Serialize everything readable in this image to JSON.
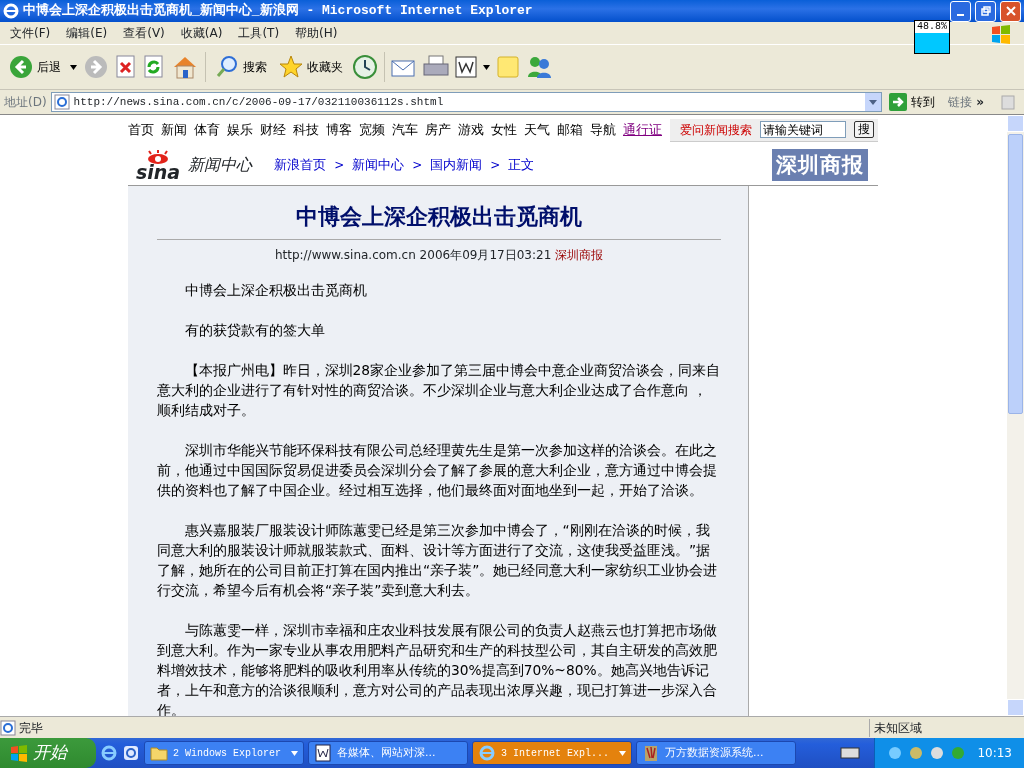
{
  "window": {
    "title": "中博会上深企积极出击觅商机_新闻中心_新浪网 - Microsoft Internet Explorer"
  },
  "overlay_meter": {
    "reading": "48.8%"
  },
  "menu": [
    "文件(F)",
    "编辑(E)",
    "查看(V)",
    "收藏(A)",
    "工具(T)",
    "帮助(H)"
  ],
  "toolbar": {
    "back": "后退",
    "search": "搜索",
    "favorites": "收藏夹"
  },
  "address_bar": {
    "label": "地址(D)",
    "url": "http://news.sina.com.cn/c/2006-09-17/032110036112s.shtml",
    "go": "转到",
    "links": "链接",
    "more": "»"
  },
  "site_nav": [
    {
      "label": "首页",
      "visited": false
    },
    {
      "label": "新闻",
      "visited": false
    },
    {
      "label": "体育",
      "visited": false
    },
    {
      "label": "娱乐",
      "visited": false
    },
    {
      "label": "财经",
      "visited": false
    },
    {
      "label": "科技",
      "visited": false
    },
    {
      "label": "博客",
      "visited": false
    },
    {
      "label": "宽频",
      "visited": false
    },
    {
      "label": "汽车",
      "visited": false
    },
    {
      "label": "房产",
      "visited": false
    },
    {
      "label": "游戏",
      "visited": false
    },
    {
      "label": "女性",
      "visited": false
    },
    {
      "label": "天气",
      "visited": false
    },
    {
      "label": "邮箱",
      "visited": false
    },
    {
      "label": "导航",
      "visited": false
    },
    {
      "label": "通行证",
      "visited": true
    }
  ],
  "search_box": {
    "label": "爱问新闻搜索",
    "value": "请输关键词",
    "button": "搜"
  },
  "channel": {
    "logo": "sina",
    "name": "新闻中心",
    "breadcrumb": [
      "新浪首页",
      "新闻中心",
      "国内新闻",
      "正文"
    ],
    "separator": ">"
  },
  "source_logo": "深圳商报",
  "article": {
    "title": "中博会上深企积极出击觅商机",
    "meta": "http://www.sina.com.cn 2006年09月17日03:21",
    "source": "深圳商报",
    "paragraphs": [
      "中博会上深企积极出击觅商机",
      "有的获贷款有的签大单",
      "【本报广州电】昨日，深圳28家企业参加了第三届中博会中意企业商贸洽谈会，同来自意大利的企业进行了有针对性的商贸洽谈。不少深圳企业与意大利企业达成了合作意向 ，顺利结成对子。",
      "深圳市华能兴节能环保科技有限公司总经理黄先生是第一次参加这样的洽谈会。在此之前，他通过中国国际贸易促进委员会深圳分会了解了参展的意大利企业，意方通过中博会提供的资料也了解了中国企业。经过相互选择，他们最终面对面地坐到一起，开始了洽谈。",
      "惠兴嘉服装厂服装设计师陈蕙雯已经是第三次参加中博会了，“刚刚在洽谈的时候，我同意大利的服装设计师就服装款式、面料、设计等方面进行了交流，这使我受益匪浅。”据了解，她所在的公司目前正打算在国内推出“亲子装”。她已经同意大利一家纺织工业协会进行交流，希望今后有机会将“亲子装”卖到意大利去。",
      "与陈蕙雯一样，深圳市幸福和庄农业科技发展有限公司的负责人赵燕云也打算把市场做到意大利。作为一家专业从事农用肥料产品研究和生产的科技型公司，其自主研发的高效肥料增效技术，能够将肥料的吸收利用率从传统的30%提高到70%~80%。她高兴地告诉记者，上午和意方的洽谈很顺利，意方对公司的产品表现出浓厚兴趣，现已打算进一步深入合作。"
    ]
  },
  "status_bar": {
    "text": "完毕",
    "zone": "未知区域"
  },
  "taskbar": {
    "start": "开始",
    "tasks": [
      {
        "label": "2 Windows Explorer",
        "kind": "folder",
        "selected": false,
        "group": true
      },
      {
        "label": "各媒体、网站对深...",
        "kind": "doc",
        "selected": false,
        "group": false
      },
      {
        "label": "3 Internet Expl...",
        "kind": "ie",
        "selected": true,
        "group": true
      },
      {
        "label": "万方数据资源系统...",
        "kind": "app",
        "selected": false,
        "group": false
      }
    ],
    "clock": "10:13"
  }
}
